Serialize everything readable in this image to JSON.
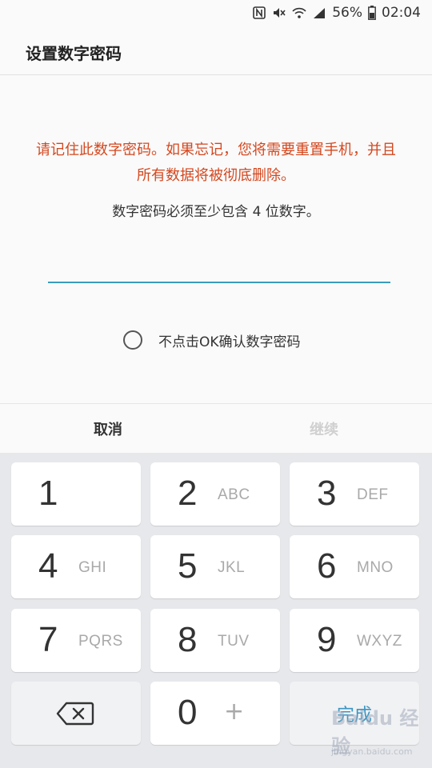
{
  "status_bar": {
    "battery": "56%",
    "time": "02:04",
    "icons": [
      "nfc-icon",
      "mute-icon",
      "wifi-icon",
      "signal-icon",
      "battery-icon"
    ]
  },
  "header": {
    "title": "设置数字密码"
  },
  "content": {
    "warning_line1": "请记住此数字密码。如果忘记，您将需要重置手机，并且",
    "warning_line2": "所有数据将被彻底删除。",
    "requirement": "数字密码必须至少包含 4 位数字。",
    "pin_value": "",
    "option_label": "不点击OK确认数字密码"
  },
  "buttons": {
    "cancel": "取消",
    "continue": "继续"
  },
  "keypad": {
    "keys": [
      {
        "digit": "1",
        "letters": ""
      },
      {
        "digit": "2",
        "letters": "ABC"
      },
      {
        "digit": "3",
        "letters": "DEF"
      },
      {
        "digit": "4",
        "letters": "GHI"
      },
      {
        "digit": "5",
        "letters": "JKL"
      },
      {
        "digit": "6",
        "letters": "MNO"
      },
      {
        "digit": "7",
        "letters": "PQRS"
      },
      {
        "digit": "8",
        "letters": "TUV"
      },
      {
        "digit": "9",
        "letters": "WXYZ"
      },
      {
        "digit": "0",
        "letters": "+"
      }
    ],
    "done": "完成"
  },
  "watermark": {
    "text": "Baidu 经验",
    "sub": "jingyan.baidu.com"
  },
  "colors": {
    "warning": "#d4481f",
    "accent": "#3a9bbd",
    "disabled": "#d0d0d0"
  }
}
